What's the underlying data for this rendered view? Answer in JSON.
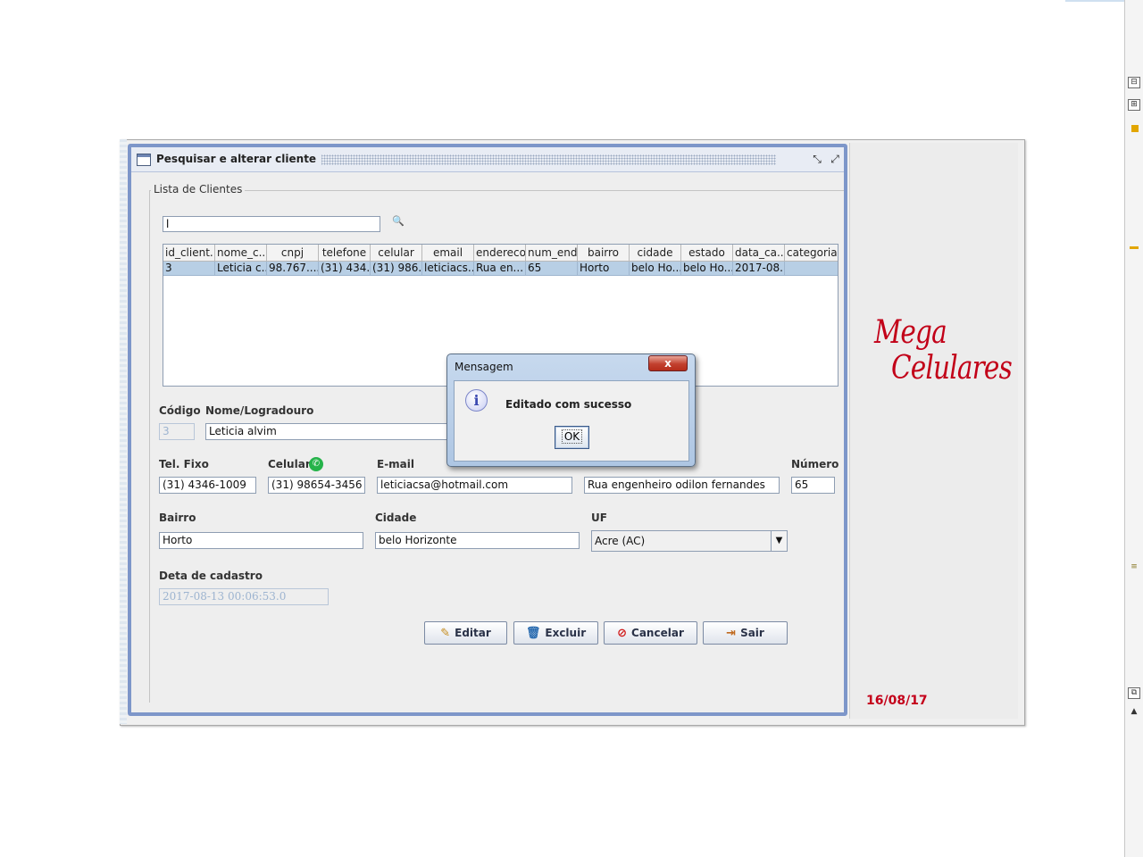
{
  "internal_frame": {
    "title": "Pesquisar e alterar cliente",
    "group_title": "Lista de Clientes",
    "search_value": "l"
  },
  "table": {
    "columns": [
      "id_client...",
      "nome_c...",
      "cnpj",
      "telefone",
      "celular",
      "email",
      "endereco",
      "num_end",
      "bairro",
      "cidade",
      "estado",
      "data_ca...",
      "categoria"
    ],
    "rows": [
      [
        "3",
        "Leticia c...",
        "98.767....",
        "(31) 434...",
        "(31) 986...",
        "leticiacs...",
        "Rua en...",
        "65",
        "Horto",
        "belo Ho...",
        "belo Ho...",
        "2017-08...",
        ""
      ]
    ]
  },
  "form": {
    "codigo_label": "Código",
    "codigo_value": "3",
    "nome_label": "Nome/Logradouro",
    "nome_value": "Leticia alvim",
    "tel_label": "Tel. Fixo",
    "tel_value": "(31) 4346-1009",
    "cel_label": "Celular",
    "cel_value": "(31) 98654-3456",
    "email_label": "E-mail",
    "email_value": "leticiacsa@hotmail.com",
    "endereco_value": "Rua engenheiro odilon fernandes",
    "numero_label": "Número",
    "numero_value": "65",
    "bairro_label": "Bairro",
    "bairro_value": "Horto",
    "cidade_label": "Cidade",
    "cidade_value": "belo Horizonte",
    "uf_label": "UF",
    "uf_value": "Acre (AC)",
    "data_label": "Deta de cadastro",
    "data_value": "2017-08-13 00:06:53.0"
  },
  "buttons": {
    "editar": "Editar",
    "excluir": "Excluir",
    "cancelar": "Cancelar",
    "sair": "Sair"
  },
  "side": {
    "logo_line1": "Mega",
    "logo_line2": "Celulares",
    "date": "16/08/17"
  },
  "dialog": {
    "title": "Mensagem",
    "message": "Editado com sucesso",
    "ok": "OK",
    "close": "x"
  },
  "colors": {
    "frame_border": "#7d96c9",
    "selected_row": "#b8cfe5",
    "brand_red": "#c20018",
    "whatsapp_green": "#25b34a"
  }
}
